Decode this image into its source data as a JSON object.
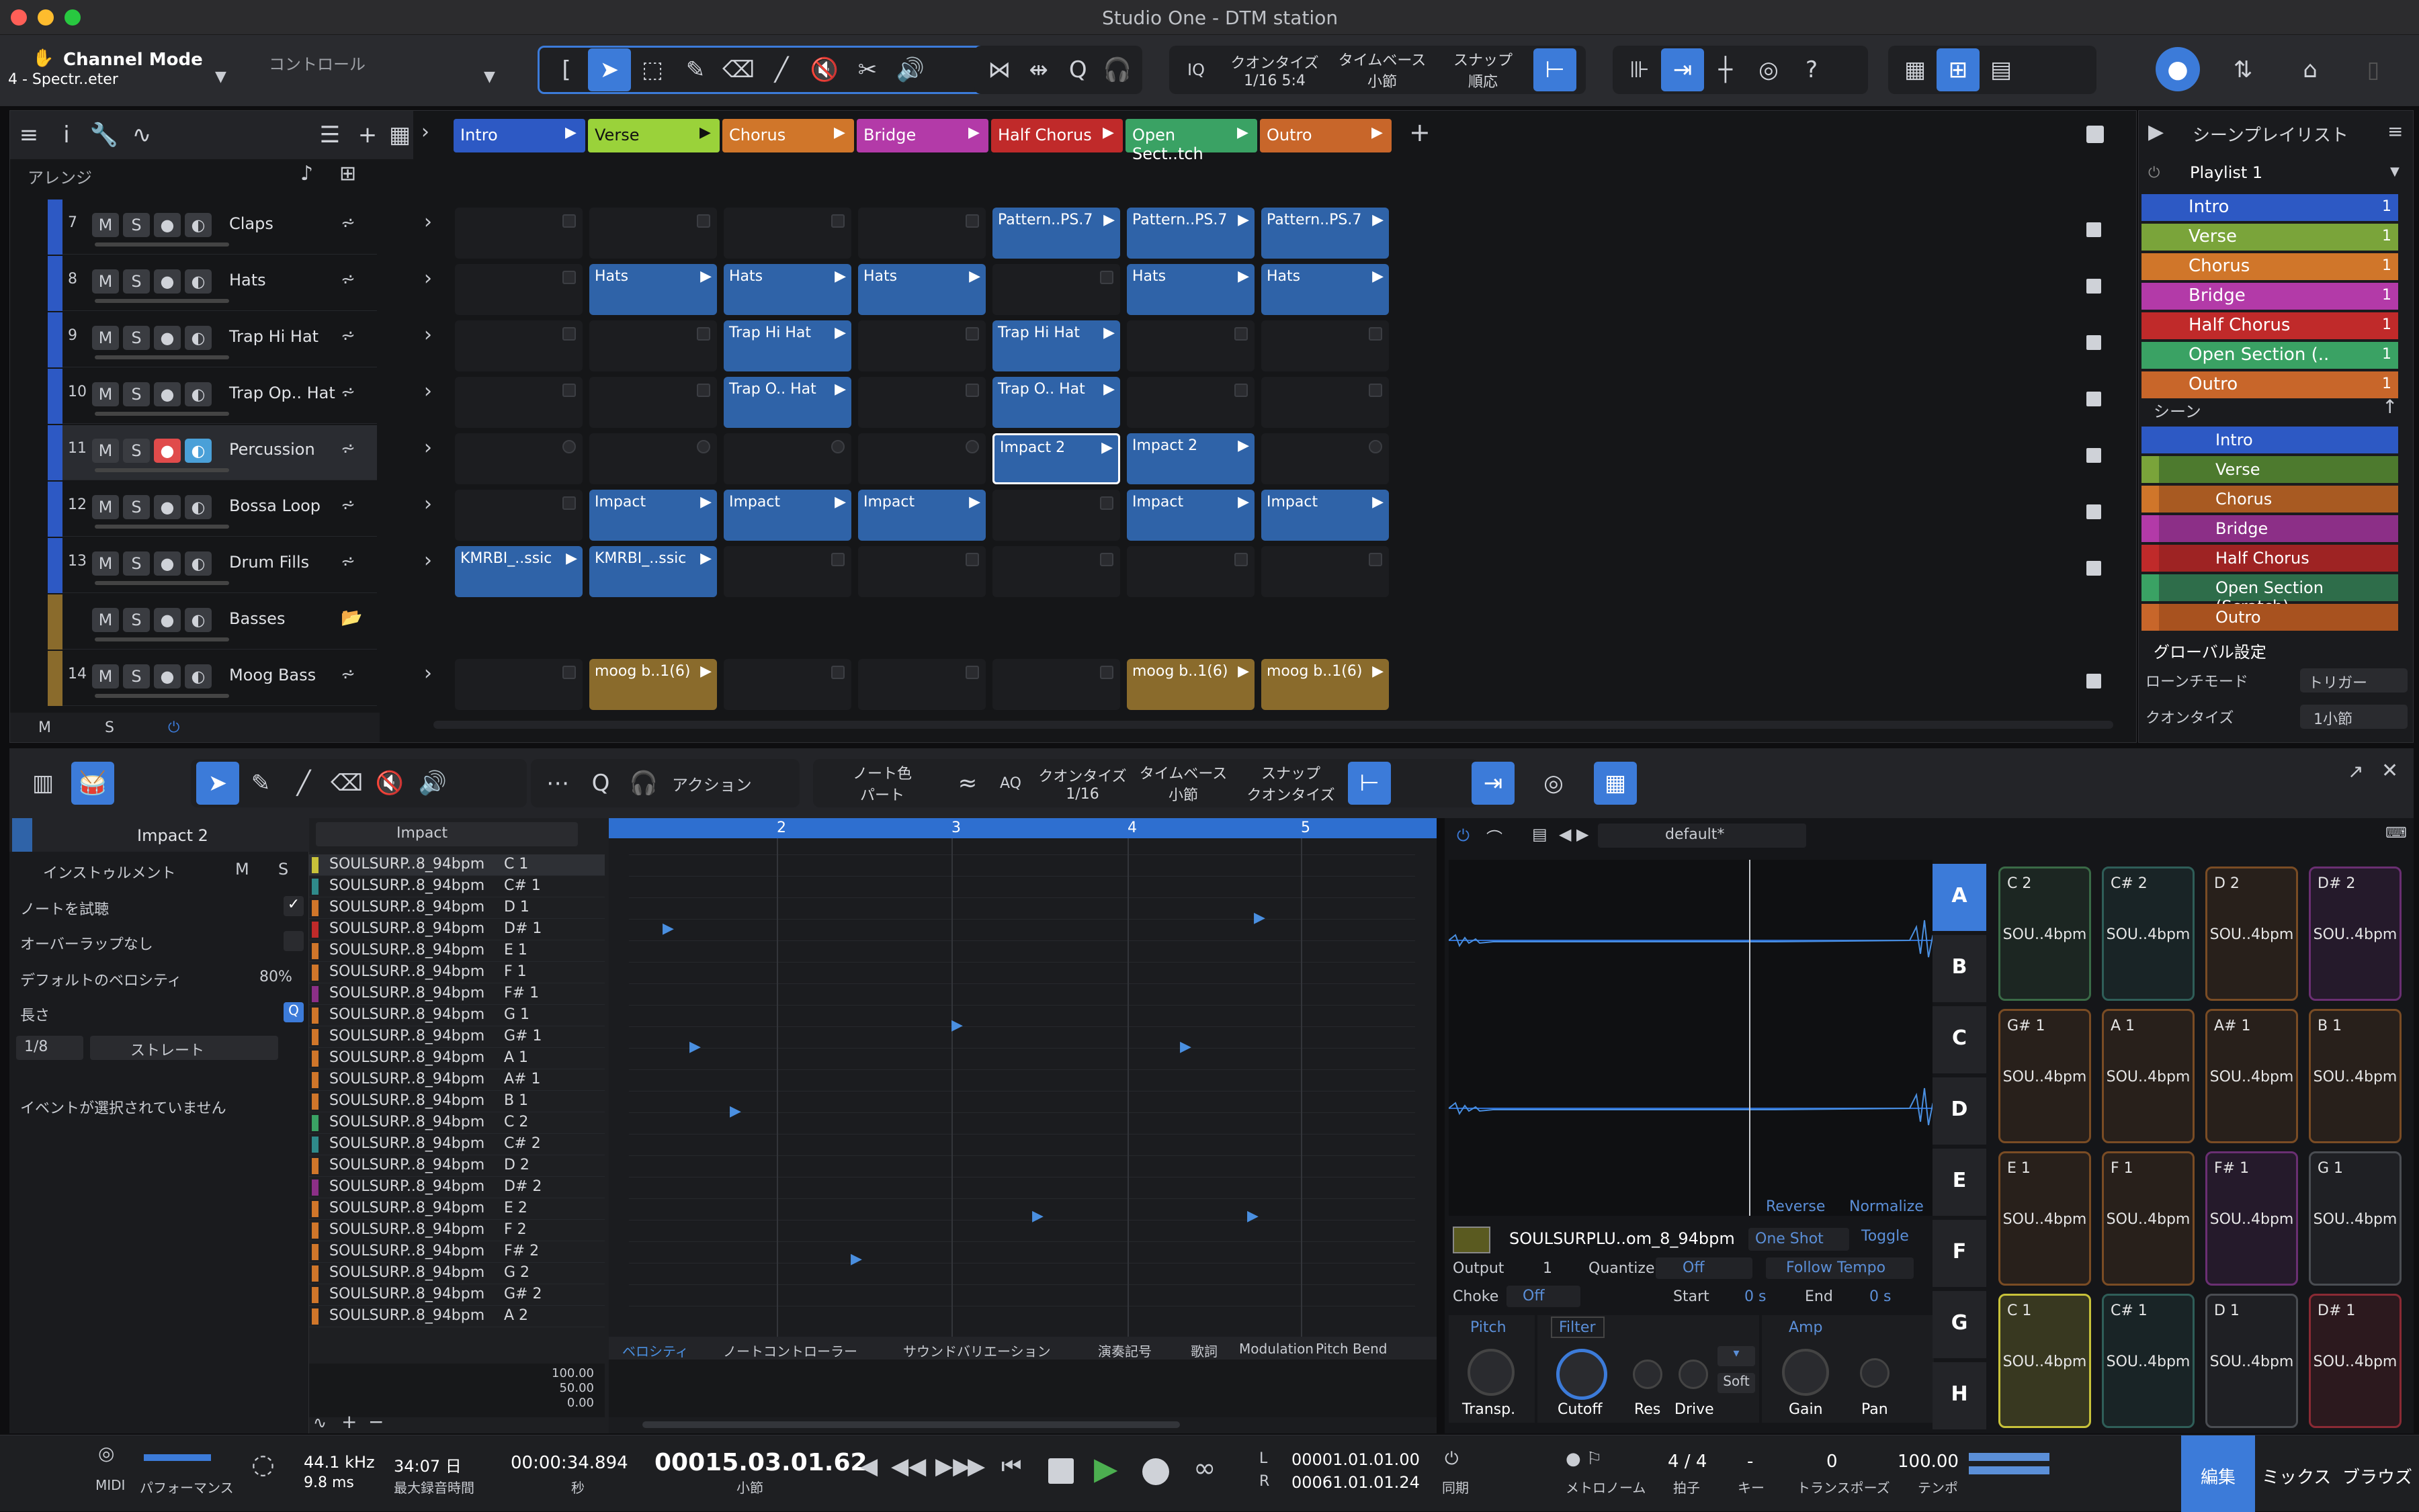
{
  "window": {
    "title": "Studio One - DTM station"
  },
  "header": {
    "channel_mode": "Channel Mode",
    "channel_sub": "4 - Spectr..eter",
    "control": "コントロール",
    "quantize_label": "クオンタイズ",
    "quantize_value": "1/16 5:4",
    "timebase_label": "タイムベース",
    "timebase_value": "小節",
    "snap_label": "スナップ",
    "snap_value": "順応"
  },
  "arrange": {
    "label": "アレンジ",
    "scenes_header": [
      "Intro",
      "Verse",
      "Chorus",
      "Bridge",
      "Half Chorus",
      "Open Sect..tch",
      "Outro"
    ],
    "tracks": [
      {
        "num": "7",
        "name": "Claps"
      },
      {
        "num": "8",
        "name": "Hats"
      },
      {
        "num": "9",
        "name": "Trap Hi Hat"
      },
      {
        "num": "10",
        "name": "Trap Op.. Hat"
      },
      {
        "num": "11",
        "name": "Percussion"
      },
      {
        "num": "12",
        "name": "Bossa Loop"
      },
      {
        "num": "13",
        "name": "Drum Fills"
      },
      {
        "num": "",
        "name": "Basses"
      },
      {
        "num": "14",
        "name": "Moog Bass"
      }
    ],
    "footer": {
      "m": "M",
      "s": "S"
    }
  },
  "clips": {
    "pattern": "Pattern..PS.7",
    "hats": "Hats",
    "trap_hi": "Trap Hi Hat",
    "trap_op": "Trap O.. Hat",
    "impact2": "Impact 2",
    "impact": "Impact",
    "kmrbi": "KMRBI_..ssic",
    "moog": "moog b..1(6)"
  },
  "playlist": {
    "title": "シーンプレイリスト",
    "name": "Playlist 1",
    "items": [
      {
        "label": "Intro",
        "count": "1",
        "color": "#2d59c4"
      },
      {
        "label": "Verse",
        "count": "1",
        "color": "#7aa43a"
      },
      {
        "label": "Chorus",
        "count": "1",
        "color": "#d0762a"
      },
      {
        "label": "Bridge",
        "count": "1",
        "color": "#b33aa8"
      },
      {
        "label": "Half Chorus",
        "count": "1",
        "color": "#c02a2a"
      },
      {
        "label": "Open Section (..",
        "count": "1",
        "color": "#3aa264"
      },
      {
        "label": "Outro",
        "count": "1",
        "color": "#c8662a"
      }
    ],
    "scenes_label": "シーン",
    "scenes": [
      {
        "label": "Intro",
        "color": "#2d59c4"
      },
      {
        "label": "Verse",
        "color": "#4d7a2e"
      },
      {
        "label": "Chorus",
        "color": "#a85a22"
      },
      {
        "label": "Bridge",
        "color": "#8c2f87"
      },
      {
        "label": "Half Chorus",
        "color": "#9e2323"
      },
      {
        "label": "Open Section (Scratch)",
        "color": "#2e6d4a"
      },
      {
        "label": "Outro",
        "color": "#a8521f"
      }
    ],
    "global": "グローバル設定",
    "launch_mode_label": "ローンチモード",
    "launch_mode_value": "トリガー",
    "quantize_label": "クオンタイズ",
    "quantize_value": "1小節"
  },
  "editor": {
    "action": "アクション",
    "note_color_label": "ノート色",
    "note_color_value": "パート",
    "quantize_label": "クオンタイズ",
    "quantize_value": "1/16",
    "timebase_label": "タイムベース",
    "timebase_value": "小節",
    "snap_label": "スナップ",
    "snap_value": "クオンタイズ",
    "event_name": "Impact 2",
    "instrument": "インストゥルメント",
    "audition": "ノートを試聴",
    "no_overlap": "オーバーラップなし",
    "default_vel": "デフォルトのベロシティ",
    "default_vel_value": "80%",
    "length": "長さ",
    "len_value": "1/8",
    "len_type": "ストレート",
    "no_event": "イベントが選択されていません",
    "track_select": "Impact",
    "ruler": [
      "2",
      "3",
      "4",
      "5"
    ],
    "keys": [
      {
        "name": "SOULSURP..8_94bpm",
        "note": "C 1"
      },
      {
        "name": "SOULSURP..8_94bpm",
        "note": "C# 1"
      },
      {
        "name": "SOULSURP..8_94bpm",
        "note": "D 1"
      },
      {
        "name": "SOULSURP..8_94bpm",
        "note": "D# 1"
      },
      {
        "name": "SOULSURP..8_94bpm",
        "note": "E 1"
      },
      {
        "name": "SOULSURP..8_94bpm",
        "note": "F 1"
      },
      {
        "name": "SOULSURP..8_94bpm",
        "note": "F# 1"
      },
      {
        "name": "SOULSURP..8_94bpm",
        "note": "G 1"
      },
      {
        "name": "SOULSURP..8_94bpm",
        "note": "G# 1"
      },
      {
        "name": "SOULSURP..8_94bpm",
        "note": "A 1"
      },
      {
        "name": "SOULSURP..8_94bpm",
        "note": "A# 1"
      },
      {
        "name": "SOULSURP..8_94bpm",
        "note": "B 1"
      },
      {
        "name": "SOULSURP..8_94bpm",
        "note": "C 2"
      },
      {
        "name": "SOULSURP..8_94bpm",
        "note": "C# 2"
      },
      {
        "name": "SOULSURP..8_94bpm",
        "note": "D 2"
      },
      {
        "name": "SOULSURP..8_94bpm",
        "note": "D# 2"
      },
      {
        "name": "SOULSURP..8_94bpm",
        "note": "E 2"
      },
      {
        "name": "SOULSURP..8_94bpm",
        "note": "F 2"
      },
      {
        "name": "SOULSURP..8_94bpm",
        "note": "F# 2"
      },
      {
        "name": "SOULSURP..8_94bpm",
        "note": "G 2"
      },
      {
        "name": "SOULSURP..8_94bpm",
        "note": "G# 2"
      },
      {
        "name": "SOULSURP..8_94bpm",
        "note": "A 2"
      }
    ],
    "tabs": [
      "ベロシティ",
      "ノートコントローラー",
      "サウンドバリエーション",
      "演奏記号",
      "歌詞",
      "Modulation",
      "Pitch Bend"
    ],
    "vel_scale": [
      "100.00",
      "50.00",
      "0.00"
    ]
  },
  "sampler": {
    "preset": "default*",
    "sample_name": "SOULSURPLU..om_8_94bpm",
    "mode": "One Shot",
    "toggle": "Toggle",
    "reverse": "Reverse",
    "normalize": "Normalize",
    "output_label": "Output",
    "output_value": "1",
    "quantize_label": "Quantize",
    "quantize_value": "Off",
    "follow_tempo": "Follow Tempo",
    "choke_label": "Choke",
    "choke_value": "Off",
    "start_label": "Start",
    "start_value": "0 s",
    "end_label": "End",
    "end_value": "0 s",
    "knobs": {
      "pitch": "Pitch",
      "transp": "Transp.",
      "filter": "Filter",
      "cutoff": "Cutoff",
      "res": "Res",
      "drive": "Drive",
      "soft": "Soft",
      "amp": "Amp",
      "gain": "Gain",
      "pan": "Pan"
    },
    "banks": [
      "A",
      "B",
      "C",
      "D",
      "E",
      "F",
      "G",
      "H"
    ],
    "pads": [
      {
        "note": "C 2",
        "val": "SOU..4bpm",
        "color": "#3a6a46"
      },
      {
        "note": "C# 2",
        "val": "SOU..4bpm",
        "color": "#2f5e58"
      },
      {
        "note": "D 2",
        "val": "SOU..4bpm",
        "color": "#7a4c24"
      },
      {
        "note": "D# 2",
        "val": "SOU..4bpm",
        "color": "#6a2f72"
      },
      {
        "note": "G# 1",
        "val": "SOU..4bpm",
        "color": "#7a4c24"
      },
      {
        "note": "A 1",
        "val": "SOU..4bpm",
        "color": "#7a4c24"
      },
      {
        "note": "A# 1",
        "val": "SOU..4bpm",
        "color": "#7a4c24"
      },
      {
        "note": "B 1",
        "val": "SOU..4bpm",
        "color": "#7a4c24"
      },
      {
        "note": "E 1",
        "val": "SOU..4bpm",
        "color": "#7a4c24"
      },
      {
        "note": "F 1",
        "val": "SOU..4bpm",
        "color": "#7a4c24"
      },
      {
        "note": "F# 1",
        "val": "SOU..4bpm",
        "color": "#6a2f72"
      },
      {
        "note": "G 1",
        "val": "SOU..4bpm",
        "color": "#4a4d52"
      },
      {
        "note": "C 1",
        "val": "SOU..4bpm",
        "color": "#c8c23a"
      },
      {
        "note": "C# 1",
        "val": "SOU..4bpm",
        "color": "#2f5e58"
      },
      {
        "note": "D 1",
        "val": "SOU..4bpm",
        "color": "#4a4d52"
      },
      {
        "note": "D# 1",
        "val": "SOU..4bpm",
        "color": "#8a2a34"
      }
    ]
  },
  "transport": {
    "midi": "MIDI",
    "performance": "パフォーマンス",
    "sample_rate": "44.1 kHz",
    "latency": "9.8 ms",
    "rec_time": "34:07 日",
    "rec_time_label": "最大録音時間",
    "seconds": "00:00:34.894",
    "seconds_label": "秒",
    "bars": "00015.03.01.62",
    "bars_label": "小節",
    "loop_l": "00001.01.01.00",
    "loop_r": "00061.01.01.24",
    "sync": "同期",
    "metronome": "メトロノーム",
    "signature": "4 / 4",
    "sig_label": "拍子",
    "key": "-",
    "key_label": "キー",
    "transpose": "0",
    "transpose_label": "トランスポーズ",
    "tempo": "100.00",
    "tempo_label": "テンポ",
    "edit": "編集",
    "mix": "ミックス",
    "browse": "ブラウズ"
  }
}
